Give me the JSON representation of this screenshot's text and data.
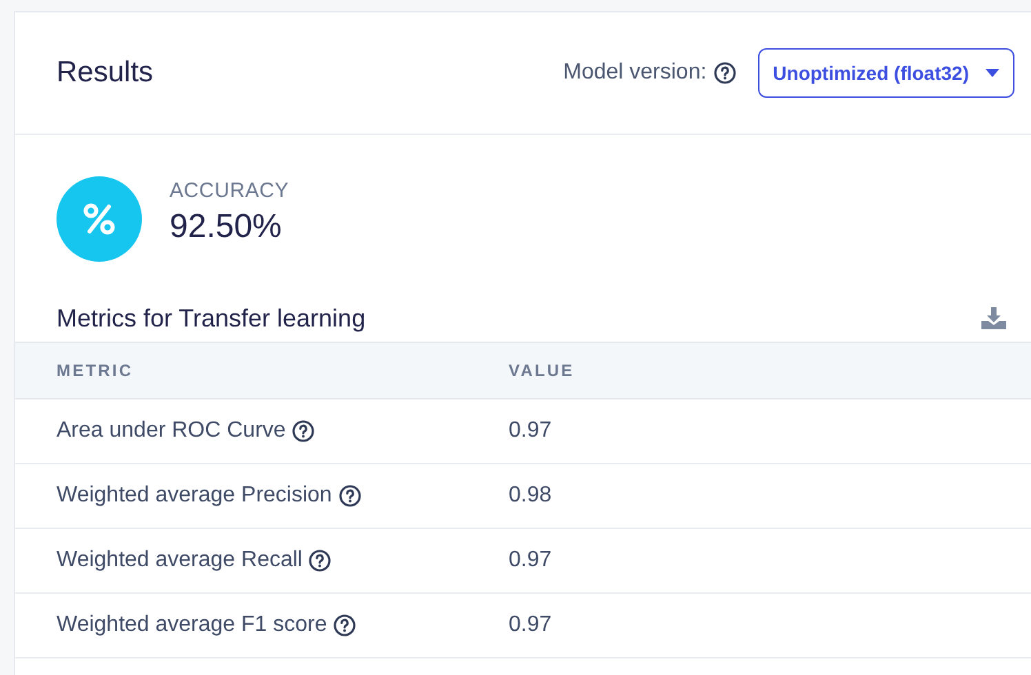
{
  "header": {
    "title": "Results",
    "model_version_label": "Model version:",
    "model_version_help": true,
    "dropdown": {
      "value": "Unoptimized (float32)"
    }
  },
  "accuracy": {
    "label": "ACCURACY",
    "value": "92.50%"
  },
  "metrics": {
    "title": "Metrics for Transfer learning",
    "columns": [
      "METRIC",
      "VALUE"
    ],
    "rows": [
      {
        "metric": "Area under ROC Curve",
        "help": true,
        "value": "0.97"
      },
      {
        "metric": "Weighted average Precision",
        "help": true,
        "value": "0.98"
      },
      {
        "metric": "Weighted average Recall",
        "help": true,
        "value": "0.97"
      },
      {
        "metric": "Weighted average F1 score",
        "help": true,
        "value": "0.97"
      }
    ]
  }
}
